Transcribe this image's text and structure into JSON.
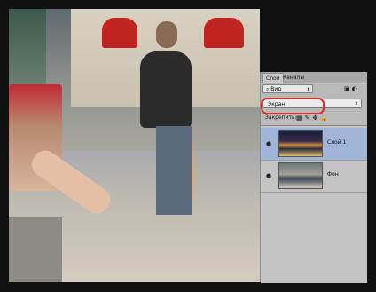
{
  "panel": {
    "tabs": [
      "Слои",
      "Каналы"
    ],
    "kind_filter": "Вид",
    "blend_mode": "Экран",
    "lock_label": "Закрепить:",
    "layers": [
      {
        "name": "Слой 1",
        "selected": true
      },
      {
        "name": "Фон",
        "selected": false
      }
    ]
  },
  "colors": {
    "highlight": "#e02c2c",
    "selected_layer": "#9fb6d9",
    "panel_bg": "#b9b9b9"
  },
  "icons": [
    "eye-icon",
    "lock-icon",
    "move-icon",
    "brush-icon",
    "image-filter-icon",
    "adjustment-filter-icon"
  ]
}
